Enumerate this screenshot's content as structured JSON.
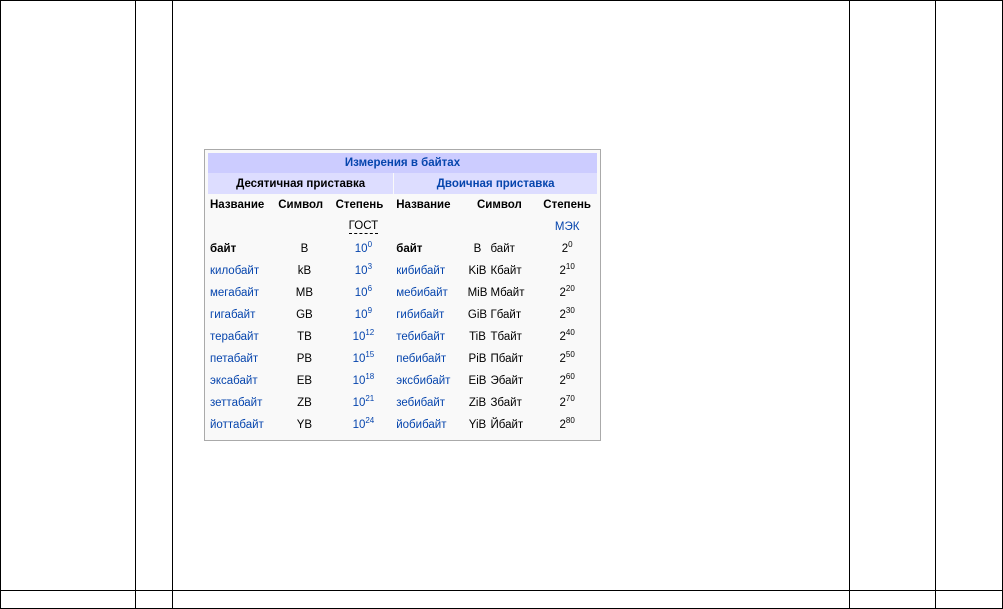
{
  "table": {
    "caption": "Измерения в байтах",
    "decimal_group": "Десятичная приставка",
    "binary_group": "Двоичная приставка",
    "headers": [
      "Название",
      "Символ",
      "Степень",
      "Название",
      "Символ",
      "Степень"
    ],
    "standard_decimal": "ГОСТ",
    "standard_binary": "МЭК",
    "rows": [
      {
        "dec_name": "байт",
        "dec_symbol": "B",
        "dec_base": "10",
        "dec_exp": "0",
        "bin_name": "байт",
        "bin_symbol": "B",
        "bin_symbol_ru": "байт",
        "bin_base": "2",
        "bin_exp": "0"
      },
      {
        "dec_name": "килобайт",
        "dec_symbol": "kB",
        "dec_base": "10",
        "dec_exp": "3",
        "bin_name": "кибибайт",
        "bin_symbol": "KiB",
        "bin_symbol_ru": "Кбайт",
        "bin_base": "2",
        "bin_exp": "10"
      },
      {
        "dec_name": "мегабайт",
        "dec_symbol": "MB",
        "dec_base": "10",
        "dec_exp": "6",
        "bin_name": "мебибайт",
        "bin_symbol": "MiB",
        "bin_symbol_ru": "Мбайт",
        "bin_base": "2",
        "bin_exp": "20"
      },
      {
        "dec_name": "гигабайт",
        "dec_symbol": "GB",
        "dec_base": "10",
        "dec_exp": "9",
        "bin_name": "гибибайт",
        "bin_symbol": "GiB",
        "bin_symbol_ru": "Гбайт",
        "bin_base": "2",
        "bin_exp": "30"
      },
      {
        "dec_name": "терабайт",
        "dec_symbol": "TB",
        "dec_base": "10",
        "dec_exp": "12",
        "bin_name": "тебибайт",
        "bin_symbol": "TiB",
        "bin_symbol_ru": "Тбайт",
        "bin_base": "2",
        "bin_exp": "40"
      },
      {
        "dec_name": "петабайт",
        "dec_symbol": "PB",
        "dec_base": "10",
        "dec_exp": "15",
        "bin_name": "пебибайт",
        "bin_symbol": "PiB",
        "bin_symbol_ru": "Пбайт",
        "bin_base": "2",
        "bin_exp": "50"
      },
      {
        "dec_name": "эксабайт",
        "dec_symbol": "EB",
        "dec_base": "10",
        "dec_exp": "18",
        "bin_name": "эксбибайт",
        "bin_symbol": "EiB",
        "bin_symbol_ru": "Эбайт",
        "bin_base": "2",
        "bin_exp": "60"
      },
      {
        "dec_name": "зеттабайт",
        "dec_symbol": "ZB",
        "dec_base": "10",
        "dec_exp": "21",
        "bin_name": "зебибайт",
        "bin_symbol": "ZiB",
        "bin_symbol_ru": "Збайт",
        "bin_base": "2",
        "bin_exp": "70"
      },
      {
        "dec_name": "йоттабайт",
        "dec_symbol": "YB",
        "dec_base": "10",
        "dec_exp": "24",
        "bin_name": "йобибайт",
        "bin_symbol": "YiB",
        "bin_symbol_ru": "Йбайт",
        "bin_base": "2",
        "bin_exp": "80"
      }
    ]
  },
  "colors": {
    "link": "#0645ad",
    "caption_bg": "#ccccff",
    "group_bg": "#ddddff",
    "table_bg": "#f9f9f9",
    "border": "#aaaaaa"
  }
}
